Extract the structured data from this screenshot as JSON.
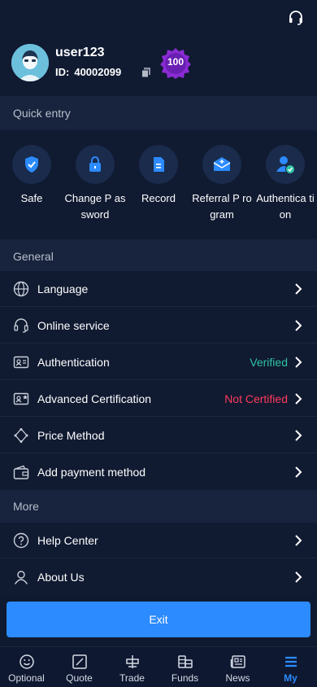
{
  "header": {
    "username": "user123",
    "id_label": "ID:",
    "id_value": "40002099",
    "level_badge": "100"
  },
  "sections": {
    "quick_entry": "Quick entry",
    "general": "General",
    "more": "More"
  },
  "quick_entry": [
    {
      "label": "Safe",
      "icon": "shield-check-icon"
    },
    {
      "label": "Change P assword",
      "icon": "lock-icon"
    },
    {
      "label": "Record",
      "icon": "document-icon"
    },
    {
      "label": "Referral P rogram",
      "icon": "mail-plus-icon"
    },
    {
      "label": "Authentica tion",
      "icon": "user-verified-icon"
    }
  ],
  "general": [
    {
      "label": "Language",
      "icon": "globe-icon",
      "status": ""
    },
    {
      "label": "Online service",
      "icon": "headset-icon",
      "status": ""
    },
    {
      "label": "Authentication",
      "icon": "id-card-icon",
      "status": "Verified"
    },
    {
      "label": "Advanced Certification",
      "icon": "id-card-star-icon",
      "status": "Not Certified"
    },
    {
      "label": "Price Method",
      "icon": "price-method-icon",
      "status": ""
    },
    {
      "label": "Add payment method",
      "icon": "wallet-icon",
      "status": ""
    }
  ],
  "more": [
    {
      "label": "Help Center",
      "icon": "help-circle-icon"
    },
    {
      "label": "About Us",
      "icon": "user-icon"
    }
  ],
  "exit_label": "Exit",
  "nav": [
    {
      "label": "Optional",
      "icon": "smile-icon",
      "active": false
    },
    {
      "label": "Quote",
      "icon": "chart-icon",
      "active": false
    },
    {
      "label": "Trade",
      "icon": "trade-icon",
      "active": false
    },
    {
      "label": "Funds",
      "icon": "coins-icon",
      "active": false
    },
    {
      "label": "News",
      "icon": "news-icon",
      "active": false
    },
    {
      "label": "My",
      "icon": "menu-icon",
      "active": true
    }
  ],
  "colors": {
    "background": "#0f1a30",
    "accent": "#2b8bff",
    "verified": "#2fc4a6",
    "not_certified": "#ff3b5c"
  }
}
